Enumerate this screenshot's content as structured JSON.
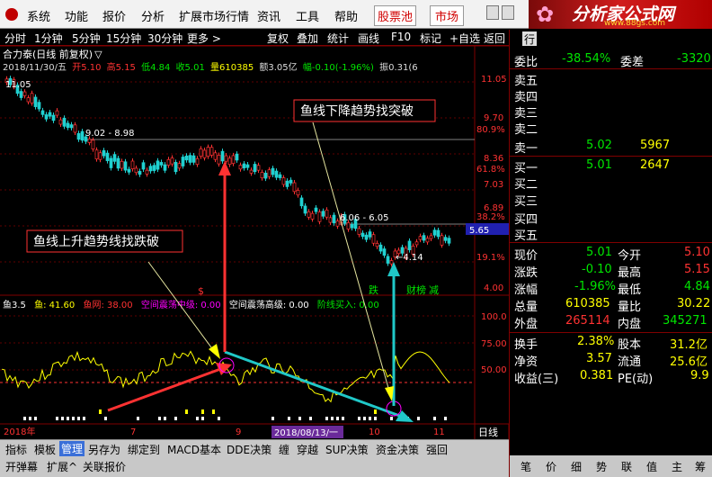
{
  "menu": {
    "system": "系统",
    "function": "功能",
    "quote": "报价",
    "analysis": "分析",
    "ext_market": "扩展市场行情",
    "news": "资讯",
    "tools": "工具",
    "help": "帮助",
    "stock_pool": "股票池",
    "market": "市场"
  },
  "logo": {
    "title": "分析家公式网",
    "url": "www.88gs.com"
  },
  "toolbar": {
    "p_fs": "分时",
    "p_1m": "1分钟",
    "p_5m": "5分钟",
    "p_15m": "15分钟",
    "p_30m": "30分钟",
    "more": "更多 >",
    "fq": "复权",
    "overlay": "叠加",
    "stats": "统计",
    "draw": "画线",
    "f10": "F10",
    "mark": "标记",
    "self": "+自选",
    "back": "返回",
    "row": "行"
  },
  "header": {
    "name": "合力泰(日线 前复权)",
    "icon": "▽",
    "date": "2018/11/30/五",
    "open": "开5.10",
    "high": "高5.15",
    "low": "低4.84",
    "close": "收5.01",
    "vol": "量610385",
    "amt": "额3.05亿",
    "chg": "幅-0.10(-1.96%)",
    "turn": "振0.31(6"
  },
  "price_axis": [
    "11.05",
    "9.70",
    "8.36",
    "7.03",
    "6.89",
    "5.65",
    "4.00"
  ],
  "pct_axis": [
    "80.9%",
    "61.8%",
    "38.2%",
    "19.1%"
  ],
  "price_tag": "5.65",
  "labels": {
    "top_price": "11.05",
    "r1": "9.02 - 8.98",
    "r2": "6.06 - 6.05",
    "low": "4.14",
    "ann_top": "鱼线下降趋势找突破",
    "ann_left": "鱼线上升趋势线找跌破",
    "sig_s": "$",
    "sig_die": "跌",
    "sig_cai": "财榜",
    "sig_jian": "减"
  },
  "ind": {
    "name": "鱼3.5",
    "yu": "鱼: 41.60",
    "yuwang": "鱼网: 38.00",
    "zhong": "空间震荡中级: 0.00",
    "gao": "空间震荡高级: 0.00",
    "buy": "阶线买入: 0.00",
    "ax100": "100.0",
    "ax75": "75.00",
    "ax50": "50.00"
  },
  "xaxis": {
    "y2018": "2018年",
    "m7": "7",
    "m9": "9",
    "cursor_date": "2018/08/13/一",
    "m10": "10",
    "m11": "11",
    "period": "日线"
  },
  "chart_data": {
    "type": "candlestick",
    "title": "合力泰(日线 前复权)",
    "last": {
      "date": "2018/11/30",
      "open": 5.1,
      "high": 5.15,
      "low": 4.84,
      "close": 5.01
    },
    "marked_high": 11.05,
    "marked_low": 4.14,
    "levels": [
      9.02,
      8.98,
      6.06,
      6.05
    ]
  },
  "quote": {
    "wb": {
      "l": "委比",
      "v": "-38.54%",
      "l2": "委差",
      "v2": "-3320"
    },
    "sell": [
      "卖五",
      "卖四",
      "卖三",
      "卖二",
      "卖一"
    ],
    "sell1": {
      "p": "5.02",
      "v": "5967"
    },
    "buy": [
      "买一",
      "买二",
      "买三",
      "买四",
      "买五"
    ],
    "buy1": {
      "p": "5.01",
      "v": "2647"
    },
    "rows": [
      {
        "l": "现价",
        "v": "5.01",
        "l2": "今开",
        "v2": "5.10"
      },
      {
        "l": "涨跌",
        "v": "-0.10",
        "l2": "最高",
        "v2": "5.15"
      },
      {
        "l": "涨幅",
        "v": "-1.96%",
        "l2": "最低",
        "v2": "4.84"
      },
      {
        "l": "总量",
        "v": "610385",
        "l2": "量比",
        "v2": "30.22"
      },
      {
        "l": "外盘",
        "v": "265114",
        "l2": "内盘",
        "v2": "345271"
      },
      {
        "l": "换手",
        "v": "2.38%",
        "l2": "股本",
        "v2": "31.2亿"
      },
      {
        "l": "净资",
        "v": "3.57",
        "l2": "流通",
        "v2": "25.6亿"
      },
      {
        "l": "收益(三)",
        "v": "0.381",
        "l2": "PE(动)",
        "v2": "9.9"
      }
    ],
    "tabs": [
      "笔",
      "价",
      "细",
      "势",
      "联",
      "值",
      "主",
      "筹"
    ]
  },
  "bottom": {
    "row1": [
      "指标",
      "模板",
      "管理",
      "另存为",
      "绑定到",
      "MACD基本",
      "DDE决策",
      "缠",
      "穿越",
      "SUP决策",
      "资金决策",
      "强回"
    ],
    "row2": [
      "开弹幕",
      "扩展^",
      "关联报价"
    ]
  }
}
